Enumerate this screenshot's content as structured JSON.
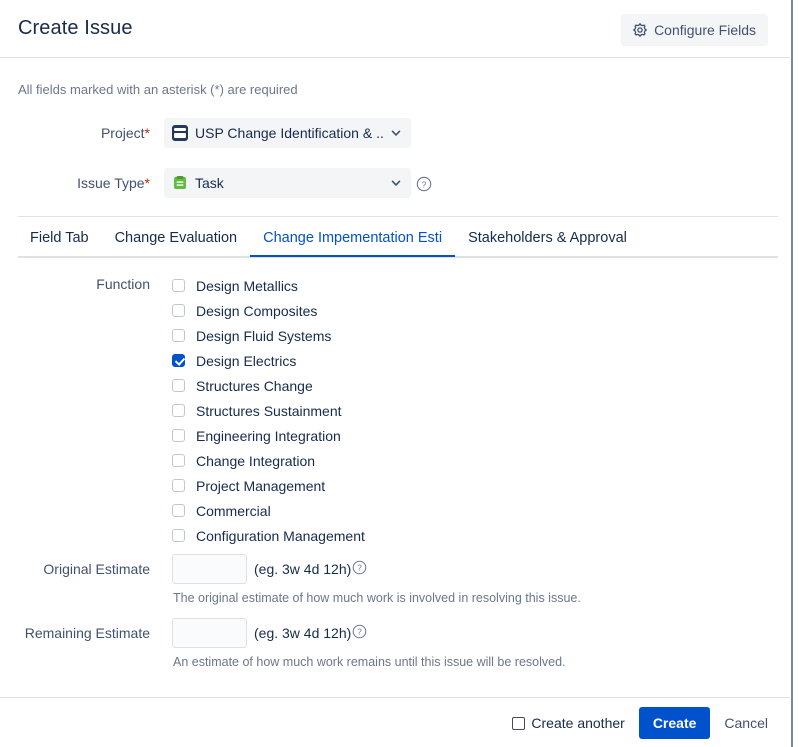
{
  "header": {
    "title": "Create Issue",
    "configure_fields_label": "Configure Fields",
    "gear_icon": "gear-icon"
  },
  "form": {
    "required_note": "All fields marked with an asterisk (*) are required",
    "project": {
      "label": "Project",
      "required_marker": "*",
      "value": "USP Change Identification & ...",
      "icon": "project-avatar-icon"
    },
    "issue_type": {
      "label": "Issue Type",
      "required_marker": "*",
      "value": "Task",
      "icon": "task-type-icon",
      "help_icon": "help-circle-icon"
    }
  },
  "tabs": [
    {
      "label": "Field Tab",
      "active": false
    },
    {
      "label": "Change Evaluation",
      "active": false
    },
    {
      "label": "Change Impementation Esti",
      "active": true
    },
    {
      "label": "Stakeholders & Approval",
      "active": false
    }
  ],
  "function_field": {
    "label": "Function",
    "options": [
      {
        "label": "Design Metallics",
        "checked": false
      },
      {
        "label": "Design Composites",
        "checked": false
      },
      {
        "label": "Design Fluid Systems",
        "checked": false
      },
      {
        "label": "Design Electrics",
        "checked": true
      },
      {
        "label": "Structures Change",
        "checked": false
      },
      {
        "label": "Structures Sustainment",
        "checked": false
      },
      {
        "label": "Engineering Integration",
        "checked": false
      },
      {
        "label": "Change Integration",
        "checked": false
      },
      {
        "label": "Project Management",
        "checked": false
      },
      {
        "label": "Commercial",
        "checked": false
      },
      {
        "label": "Configuration Management",
        "checked": false
      }
    ]
  },
  "original_estimate": {
    "label": "Original Estimate",
    "value": "",
    "placeholder": "",
    "hint": "(eg. 3w 4d 12h)",
    "help_icon": "help-circle-icon",
    "description": "The original estimate of how much work is involved in resolving this issue."
  },
  "remaining_estimate": {
    "label": "Remaining Estimate",
    "value": "",
    "placeholder": "",
    "hint": "(eg. 3w 4d 12h)",
    "help_icon": "help-circle-icon",
    "description": "An estimate of how much work remains until this issue will be resolved."
  },
  "footer": {
    "create_another_label": "Create another",
    "create_another_checked": false,
    "create_label": "Create",
    "cancel_label": "Cancel"
  },
  "colors": {
    "accent": "#0052CC",
    "text": "#172B4D",
    "subtle_text": "#6B778C",
    "label_text": "#42526E",
    "border": "#DFE1E6",
    "field_bg": "#F4F5F7",
    "required_star": "#BF2600",
    "project_icon_bg": "#253858",
    "task_icon_green": "#65BA43"
  }
}
